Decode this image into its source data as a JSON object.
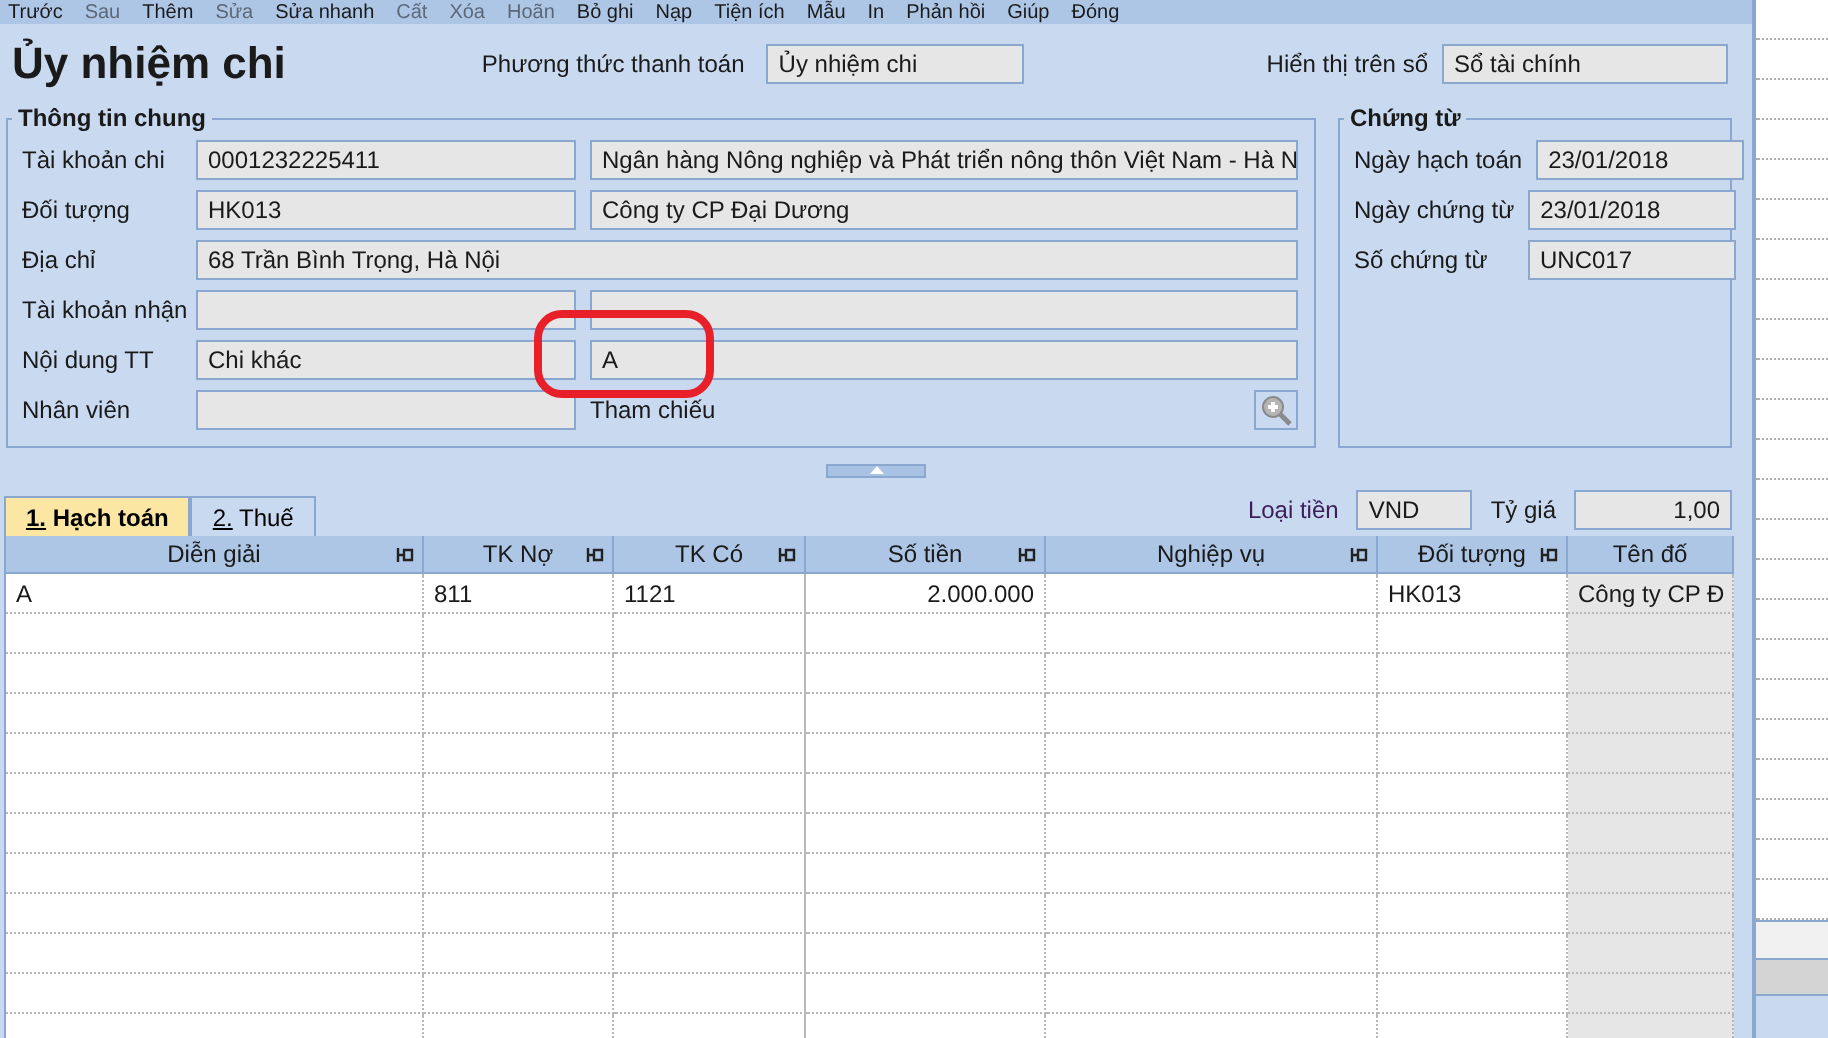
{
  "toolbar": [
    {
      "label": "Trước",
      "disabled": false
    },
    {
      "label": "Sau",
      "disabled": true
    },
    {
      "label": "Thêm",
      "disabled": false
    },
    {
      "label": "Sửa",
      "disabled": true
    },
    {
      "label": "Sửa nhanh",
      "disabled": false
    },
    {
      "label": "Cất",
      "disabled": true
    },
    {
      "label": "Xóa",
      "disabled": true
    },
    {
      "label": "Hoãn",
      "disabled": true
    },
    {
      "label": "Bỏ ghi",
      "disabled": false
    },
    {
      "label": "Nạp",
      "disabled": false
    },
    {
      "label": "Tiện ích",
      "disabled": false
    },
    {
      "label": "Mẫu",
      "disabled": false
    },
    {
      "label": "In",
      "disabled": false
    },
    {
      "label": "Phản hồi",
      "disabled": false
    },
    {
      "label": "Giúp",
      "disabled": false
    },
    {
      "label": "Đóng",
      "disabled": false
    }
  ],
  "title": "Ủy nhiệm chi",
  "payment_method": {
    "label": "Phương thức thanh toán",
    "value": "Ủy nhiệm chi"
  },
  "show_on_book": {
    "label": "Hiển thị trên sổ",
    "value": "Sổ tài chính"
  },
  "general": {
    "title": "Thông tin chung",
    "rows": [
      {
        "kind": "double",
        "label": "Tài khoản chi",
        "value": "0001232225411",
        "value_2": "Ngân hàng Nông nghiệp và Phát triển nông thôn Việt Nam - Hà N"
      },
      {
        "kind": "double",
        "label": "Đối tượng",
        "value": "HK013",
        "value_2": "Công ty CP Đại Dương"
      },
      {
        "kind": "wide",
        "label": "Địa chỉ",
        "value": "68 Trần Bình Trọng, Hà Nội"
      },
      {
        "kind": "double",
        "label": "Tài khoản nhận"
      },
      {
        "kind": "double",
        "label": "Nội dung TT",
        "value": "Chi khác",
        "value_2": "A"
      },
      {
        "kind": "reference",
        "label": "Nhân viên",
        "reference_label": "Tham chiếu"
      }
    ]
  },
  "documents": {
    "title": "Chứng từ",
    "fields": [
      {
        "label": "Ngày hạch toán",
        "value": "23/01/2018"
      },
      {
        "label": "Ngày chứng từ",
        "value": "23/01/2018"
      },
      {
        "label": "Số chứng từ",
        "value": "UNC017"
      }
    ]
  },
  "tabs": [
    {
      "label": "1. Hạch toán",
      "selected": true
    },
    {
      "label": "2. Thuế",
      "selected": false
    }
  ],
  "currency": {
    "label": "Loại tiền",
    "value": "VND"
  },
  "rate": {
    "label": "Tỷ giá",
    "value": "1,00"
  },
  "table": {
    "columns": [
      {
        "label": "Diễn giải",
        "pinned": true,
        "kind": "text"
      },
      {
        "label": "TK Nợ",
        "pinned": true,
        "kind": "text"
      },
      {
        "label": "TK Có",
        "pinned": true,
        "kind": "text"
      },
      {
        "label": "Số tiền",
        "pinned": true,
        "kind": "amount"
      },
      {
        "label": "Nghiệp vụ",
        "pinned": true,
        "kind": "text"
      },
      {
        "label": "Đối tượng",
        "pinned": true,
        "kind": "text"
      },
      {
        "label": "Tên đố",
        "pinned": false,
        "kind": "readonly"
      }
    ],
    "rows": [
      [
        "A",
        "811",
        "1121",
        "2.000.000",
        "",
        "HK013",
        "Công ty CP Đ"
      ]
    ]
  }
}
